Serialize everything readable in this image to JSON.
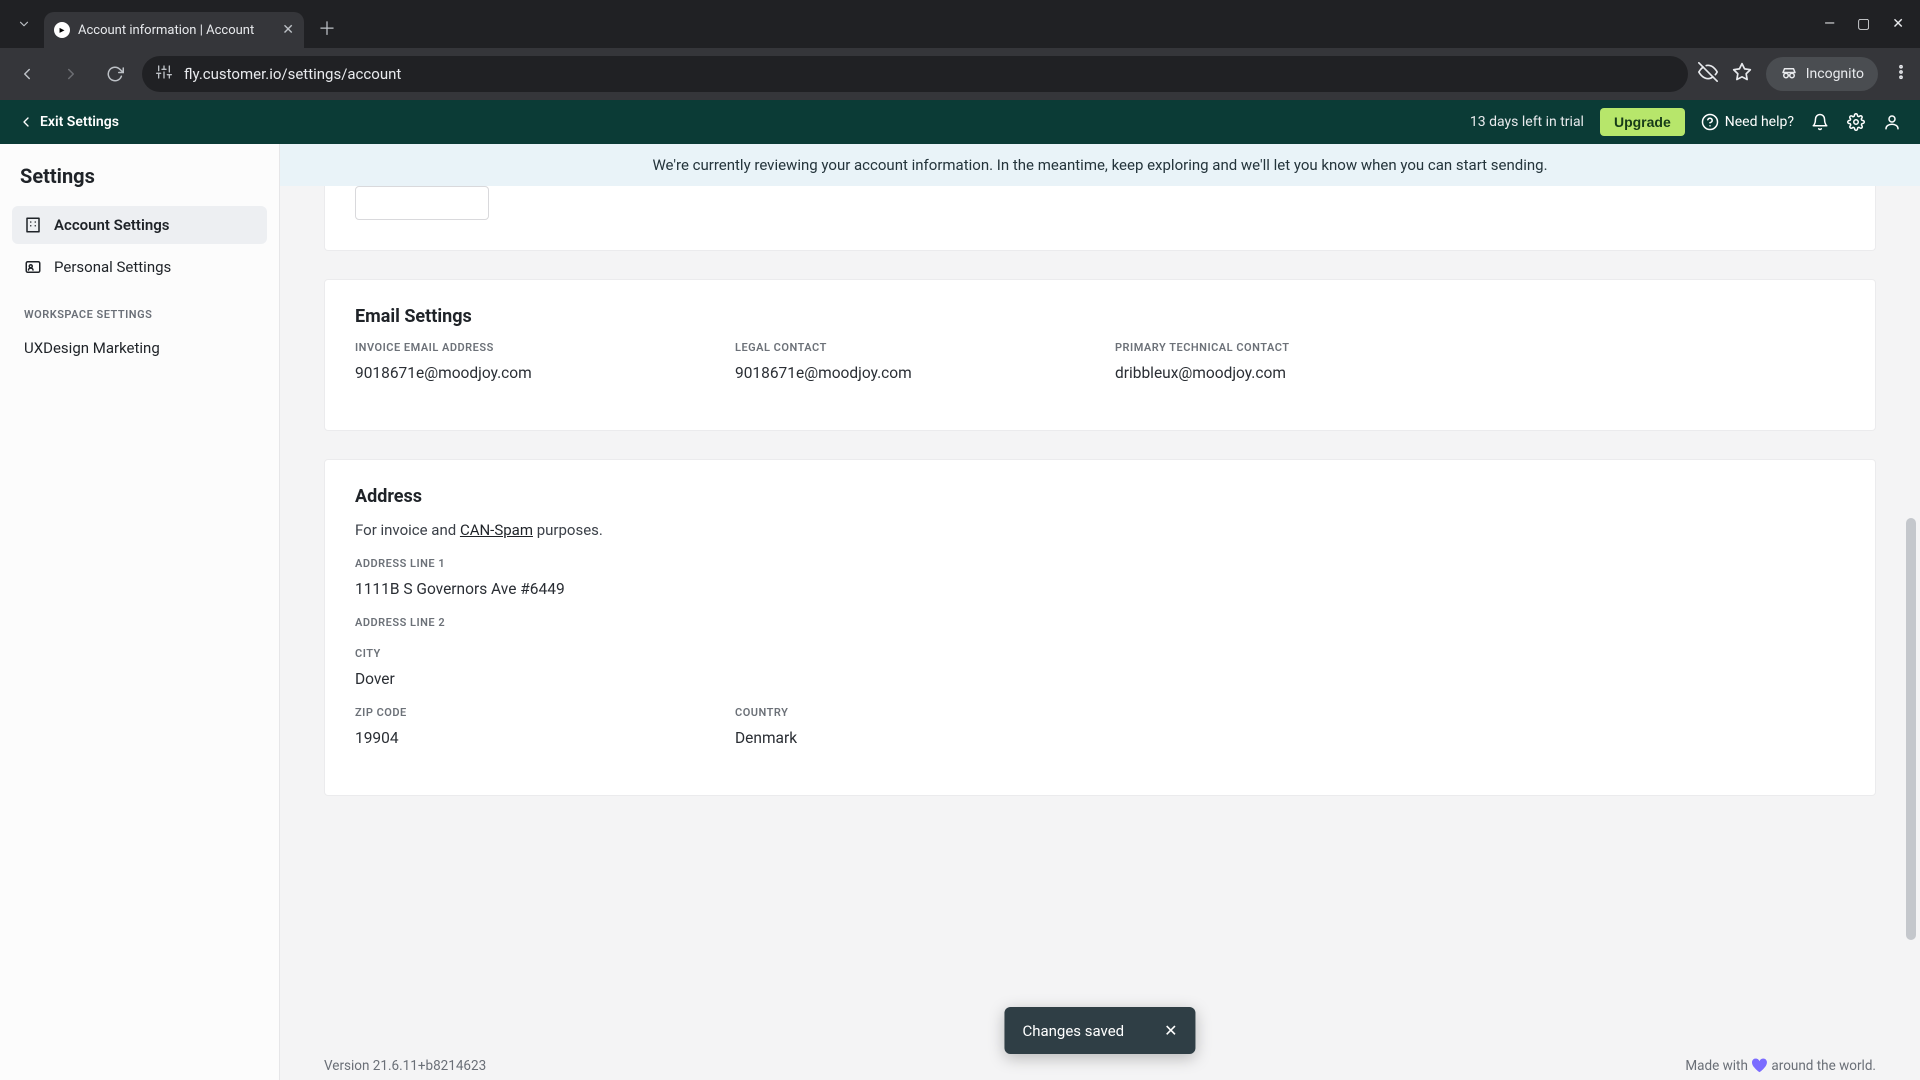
{
  "browser": {
    "tab_title": "Account information | Account",
    "url": "fly.customer.io/settings/account",
    "incognito_label": "Incognito"
  },
  "header": {
    "exit_label": "Exit Settings",
    "trial_text": "13 days left in trial",
    "upgrade_label": "Upgrade",
    "need_help_label": "Need help?"
  },
  "sidebar": {
    "title": "Settings",
    "items": [
      {
        "label": "Account Settings"
      },
      {
        "label": "Personal Settings"
      }
    ],
    "group_label": "WORKSPACE SETTINGS",
    "workspace_item": "UXDesign Marketing"
  },
  "banner": {
    "text": "We're currently reviewing your account information. In the meantime, keep exploring and we'll let you know when you can start sending."
  },
  "email_settings": {
    "title": "Email Settings",
    "invoice_label": "INVOICE EMAIL ADDRESS",
    "invoice_value": "9018671e@moodjoy.com",
    "legal_label": "LEGAL CONTACT",
    "legal_value": "9018671e@moodjoy.com",
    "tech_label": "PRIMARY TECHNICAL CONTACT",
    "tech_value": "dribbleux@moodjoy.com"
  },
  "address": {
    "title": "Address",
    "desc_prefix": "For invoice and ",
    "desc_link": "CAN-Spam",
    "desc_suffix": " purposes.",
    "line1_label": "ADDRESS LINE 1",
    "line1_value": "1111B S Governors Ave #6449",
    "line2_label": "ADDRESS LINE 2",
    "line2_value": "",
    "city_label": "CITY",
    "city_value": "Dover",
    "zip_label": "ZIP CODE",
    "zip_value": "19904",
    "country_label": "COUNTRY",
    "country_value": "Denmark"
  },
  "toast": {
    "text": "Changes saved"
  },
  "footer": {
    "version": "Version 21.6.11+b8214623",
    "made_prefix": "Made with ",
    "made_suffix": " around the world."
  }
}
